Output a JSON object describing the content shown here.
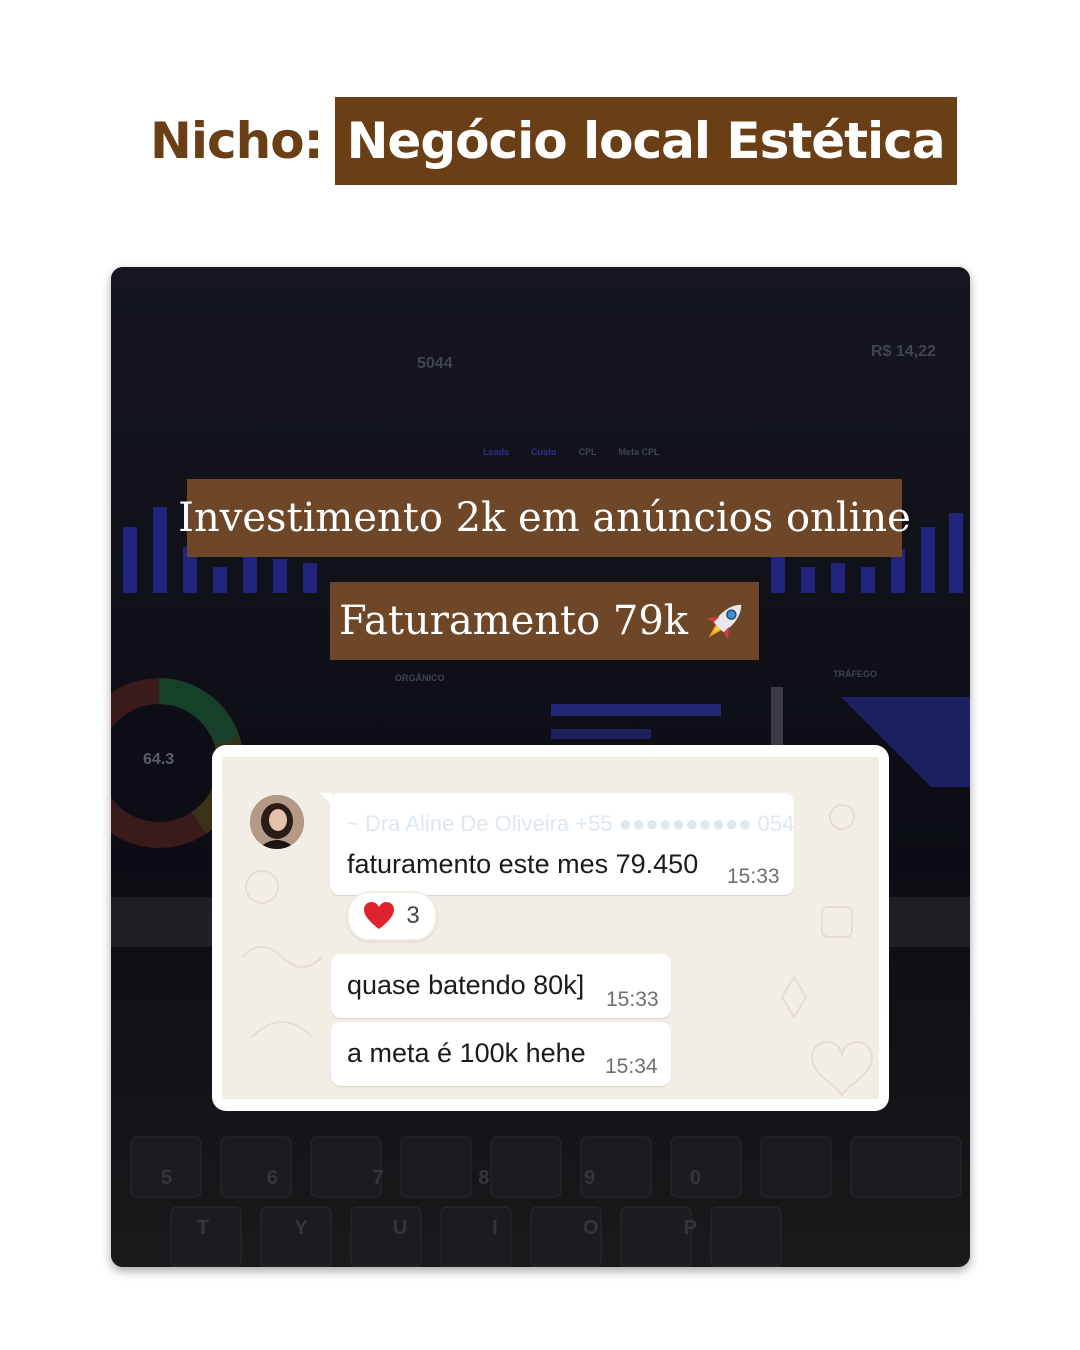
{
  "header": {
    "label": "Nicho:",
    "niche": "Negócio local Estética"
  },
  "background_dashboard": {
    "metric_left": "5044",
    "metric_right": "R$ 14,22",
    "donut_value": "64.3",
    "section_left": "ORGÂNICO",
    "section_right": "TRÁFEGO",
    "legend": [
      "Leads",
      "Custo",
      "CPL",
      "Meta CPL"
    ],
    "keys": [
      "5",
      "6",
      "7",
      "8",
      "9",
      "0",
      "T",
      "Y",
      "U",
      "I",
      "O",
      "P"
    ]
  },
  "captions": {
    "investment": "Investimento 2k em anúncios online",
    "revenue": "Faturamento 79k"
  },
  "chat": {
    "sender": "~ Dra Aline De Oliveira +55 ●●●●●●●●●● 054",
    "messages": [
      {
        "text": "faturamento este mes 79.450",
        "time": "15:33"
      },
      {
        "text": "quase batendo 80k]",
        "time": "15:33"
      },
      {
        "text": "a meta é 100k hehe",
        "time": "15:34"
      }
    ],
    "reaction": {
      "emoji": "heart-icon",
      "count": "3"
    }
  },
  "colors": {
    "brown": "#6b3f16",
    "banner": "#6e4628",
    "dashboard_bar": "#2a2fa8",
    "chat_bg": "#f3eee5"
  }
}
